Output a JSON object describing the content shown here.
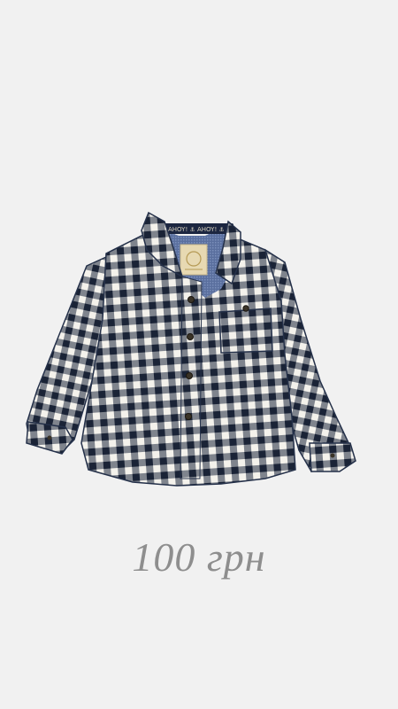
{
  "listing": {
    "price_text": "100 грн",
    "background_color": "#f1f1f1",
    "price_color": "#8e8e8e"
  },
  "product_image": {
    "subject": "shirt-icon",
    "pattern": "gingham",
    "pattern_colors": [
      "#1f2a40",
      "#f4f2ec"
    ],
    "label_colors": [
      "#e7d9b2"
    ],
    "collar_tape_text": "AHOY!"
  }
}
